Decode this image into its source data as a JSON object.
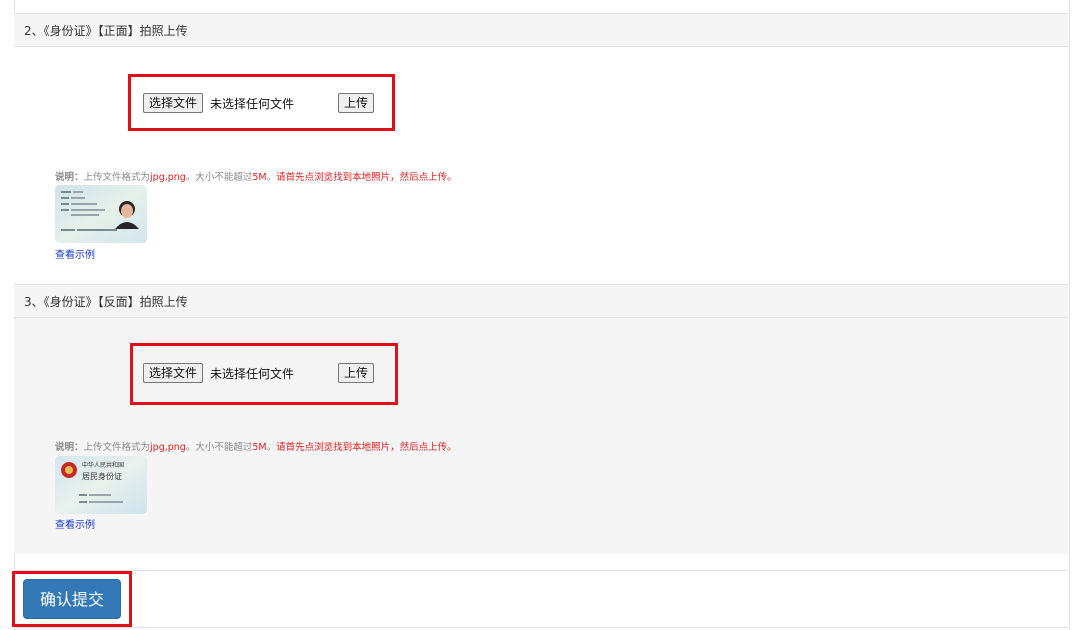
{
  "section2": {
    "title": "2、《身份证》【正面】拍照上传",
    "choose_file_label": "选择文件",
    "no_file_text": "未选择任何文件",
    "upload_label": "上传",
    "note_label": "说明：",
    "note_gray": "上传文件格式为",
    "note_formats": "jpg,png",
    "note_gray2": "。大小不能超过",
    "note_size": "5M",
    "note_gray3": "。",
    "note_red": "请首先点浏览找到本地照片，然后点上传。",
    "sample_link": "查看示例",
    "sample_image": "id-card-front-sample"
  },
  "section3": {
    "title": "3、《身份证》【反面】拍照上传",
    "choose_file_label": "选择文件",
    "no_file_text": "未选择任何文件",
    "upload_label": "上传",
    "note_label": "说明：",
    "note_gray": "上传文件格式为",
    "note_formats": "jpg,png",
    "note_gray2": "。大小不能超过",
    "note_size": "5M",
    "note_gray3": "。",
    "note_red": "请首先点浏览找到本地照片，然后点上传。",
    "sample_link": "查看示例",
    "sample_image": "id-card-back-sample",
    "card_line1": "中华人民共和国",
    "card_line2": "居民身份证"
  },
  "submit": {
    "label": "确认提交"
  },
  "colors": {
    "highlight": "#e0101a",
    "submit_bg": "#3379b7",
    "link": "#1a3ac8",
    "note_red": "#e02020"
  }
}
